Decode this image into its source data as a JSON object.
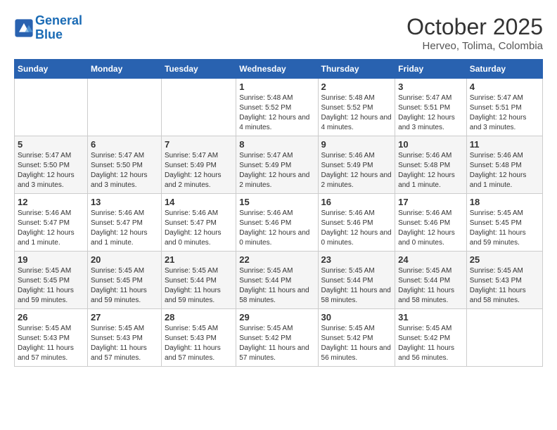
{
  "header": {
    "logo_line1": "General",
    "logo_line2": "Blue",
    "month": "October 2025",
    "location": "Herveo, Tolima, Colombia"
  },
  "weekdays": [
    "Sunday",
    "Monday",
    "Tuesday",
    "Wednesday",
    "Thursday",
    "Friday",
    "Saturday"
  ],
  "weeks": [
    [
      {
        "day": "",
        "sunrise": "",
        "sunset": "",
        "daylight": ""
      },
      {
        "day": "",
        "sunrise": "",
        "sunset": "",
        "daylight": ""
      },
      {
        "day": "",
        "sunrise": "",
        "sunset": "",
        "daylight": ""
      },
      {
        "day": "1",
        "sunrise": "Sunrise: 5:48 AM",
        "sunset": "Sunset: 5:52 PM",
        "daylight": "Daylight: 12 hours and 4 minutes."
      },
      {
        "day": "2",
        "sunrise": "Sunrise: 5:48 AM",
        "sunset": "Sunset: 5:52 PM",
        "daylight": "Daylight: 12 hours and 4 minutes."
      },
      {
        "day": "3",
        "sunrise": "Sunrise: 5:47 AM",
        "sunset": "Sunset: 5:51 PM",
        "daylight": "Daylight: 12 hours and 3 minutes."
      },
      {
        "day": "4",
        "sunrise": "Sunrise: 5:47 AM",
        "sunset": "Sunset: 5:51 PM",
        "daylight": "Daylight: 12 hours and 3 minutes."
      }
    ],
    [
      {
        "day": "5",
        "sunrise": "Sunrise: 5:47 AM",
        "sunset": "Sunset: 5:50 PM",
        "daylight": "Daylight: 12 hours and 3 minutes."
      },
      {
        "day": "6",
        "sunrise": "Sunrise: 5:47 AM",
        "sunset": "Sunset: 5:50 PM",
        "daylight": "Daylight: 12 hours and 3 minutes."
      },
      {
        "day": "7",
        "sunrise": "Sunrise: 5:47 AM",
        "sunset": "Sunset: 5:49 PM",
        "daylight": "Daylight: 12 hours and 2 minutes."
      },
      {
        "day": "8",
        "sunrise": "Sunrise: 5:47 AM",
        "sunset": "Sunset: 5:49 PM",
        "daylight": "Daylight: 12 hours and 2 minutes."
      },
      {
        "day": "9",
        "sunrise": "Sunrise: 5:46 AM",
        "sunset": "Sunset: 5:49 PM",
        "daylight": "Daylight: 12 hours and 2 minutes."
      },
      {
        "day": "10",
        "sunrise": "Sunrise: 5:46 AM",
        "sunset": "Sunset: 5:48 PM",
        "daylight": "Daylight: 12 hours and 1 minute."
      },
      {
        "day": "11",
        "sunrise": "Sunrise: 5:46 AM",
        "sunset": "Sunset: 5:48 PM",
        "daylight": "Daylight: 12 hours and 1 minute."
      }
    ],
    [
      {
        "day": "12",
        "sunrise": "Sunrise: 5:46 AM",
        "sunset": "Sunset: 5:47 PM",
        "daylight": "Daylight: 12 hours and 1 minute."
      },
      {
        "day": "13",
        "sunrise": "Sunrise: 5:46 AM",
        "sunset": "Sunset: 5:47 PM",
        "daylight": "Daylight: 12 hours and 1 minute."
      },
      {
        "day": "14",
        "sunrise": "Sunrise: 5:46 AM",
        "sunset": "Sunset: 5:47 PM",
        "daylight": "Daylight: 12 hours and 0 minutes."
      },
      {
        "day": "15",
        "sunrise": "Sunrise: 5:46 AM",
        "sunset": "Sunset: 5:46 PM",
        "daylight": "Daylight: 12 hours and 0 minutes."
      },
      {
        "day": "16",
        "sunrise": "Sunrise: 5:46 AM",
        "sunset": "Sunset: 5:46 PM",
        "daylight": "Daylight: 12 hours and 0 minutes."
      },
      {
        "day": "17",
        "sunrise": "Sunrise: 5:46 AM",
        "sunset": "Sunset: 5:46 PM",
        "daylight": "Daylight: 12 hours and 0 minutes."
      },
      {
        "day": "18",
        "sunrise": "Sunrise: 5:45 AM",
        "sunset": "Sunset: 5:45 PM",
        "daylight": "Daylight: 11 hours and 59 minutes."
      }
    ],
    [
      {
        "day": "19",
        "sunrise": "Sunrise: 5:45 AM",
        "sunset": "Sunset: 5:45 PM",
        "daylight": "Daylight: 11 hours and 59 minutes."
      },
      {
        "day": "20",
        "sunrise": "Sunrise: 5:45 AM",
        "sunset": "Sunset: 5:45 PM",
        "daylight": "Daylight: 11 hours and 59 minutes."
      },
      {
        "day": "21",
        "sunrise": "Sunrise: 5:45 AM",
        "sunset": "Sunset: 5:44 PM",
        "daylight": "Daylight: 11 hours and 59 minutes."
      },
      {
        "day": "22",
        "sunrise": "Sunrise: 5:45 AM",
        "sunset": "Sunset: 5:44 PM",
        "daylight": "Daylight: 11 hours and 58 minutes."
      },
      {
        "day": "23",
        "sunrise": "Sunrise: 5:45 AM",
        "sunset": "Sunset: 5:44 PM",
        "daylight": "Daylight: 11 hours and 58 minutes."
      },
      {
        "day": "24",
        "sunrise": "Sunrise: 5:45 AM",
        "sunset": "Sunset: 5:44 PM",
        "daylight": "Daylight: 11 hours and 58 minutes."
      },
      {
        "day": "25",
        "sunrise": "Sunrise: 5:45 AM",
        "sunset": "Sunset: 5:43 PM",
        "daylight": "Daylight: 11 hours and 58 minutes."
      }
    ],
    [
      {
        "day": "26",
        "sunrise": "Sunrise: 5:45 AM",
        "sunset": "Sunset: 5:43 PM",
        "daylight": "Daylight: 11 hours and 57 minutes."
      },
      {
        "day": "27",
        "sunrise": "Sunrise: 5:45 AM",
        "sunset": "Sunset: 5:43 PM",
        "daylight": "Daylight: 11 hours and 57 minutes."
      },
      {
        "day": "28",
        "sunrise": "Sunrise: 5:45 AM",
        "sunset": "Sunset: 5:43 PM",
        "daylight": "Daylight: 11 hours and 57 minutes."
      },
      {
        "day": "29",
        "sunrise": "Sunrise: 5:45 AM",
        "sunset": "Sunset: 5:42 PM",
        "daylight": "Daylight: 11 hours and 57 minutes."
      },
      {
        "day": "30",
        "sunrise": "Sunrise: 5:45 AM",
        "sunset": "Sunset: 5:42 PM",
        "daylight": "Daylight: 11 hours and 56 minutes."
      },
      {
        "day": "31",
        "sunrise": "Sunrise: 5:45 AM",
        "sunset": "Sunset: 5:42 PM",
        "daylight": "Daylight: 11 hours and 56 minutes."
      },
      {
        "day": "",
        "sunrise": "",
        "sunset": "",
        "daylight": ""
      }
    ]
  ]
}
